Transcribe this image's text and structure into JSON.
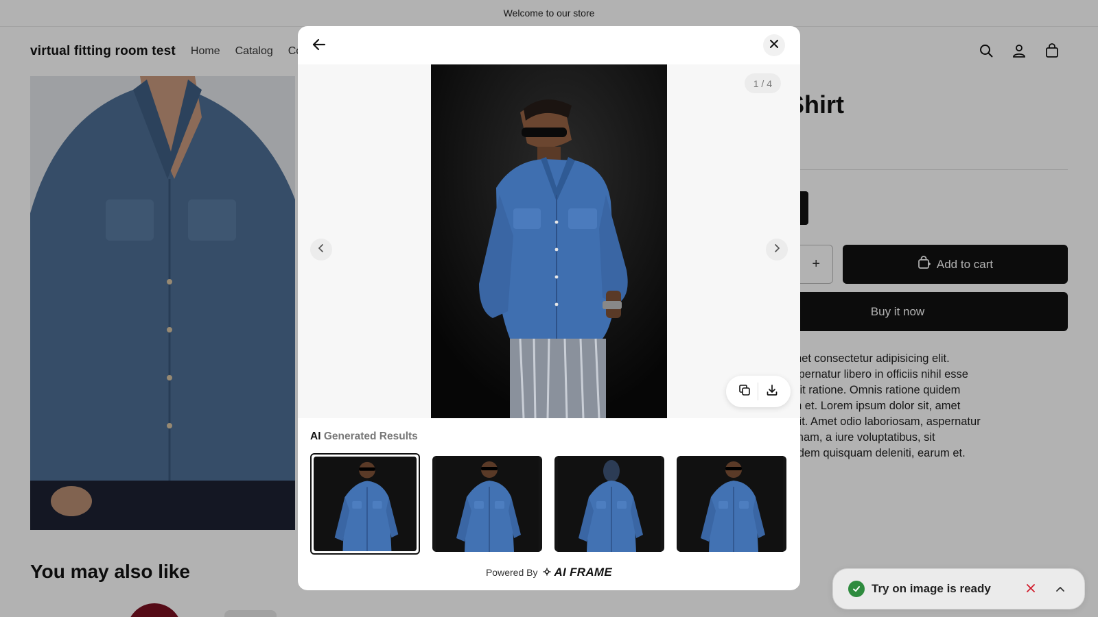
{
  "announcement": {
    "text": "Welcome to our store"
  },
  "header": {
    "store_name": "virtual fitting room test",
    "nav": [
      "Home",
      "Catalog",
      "Co"
    ],
    "icons": [
      "search-icon",
      "account-icon",
      "cart-icon"
    ]
  },
  "product": {
    "title_fragment": "uroy Shirt",
    "qty_plus": "+",
    "add_to_cart": "Add to cart",
    "buy_now": "Buy it now",
    "description_lines": [
      "m dolor sit, amet consectetur adipisicing elit.",
      "aboriosam, aspernatur libero in officiis nihil esse",
      "voluptatibus, sit ratione. Omnis ratione quidem",
      "deleniti, earum et. Lorem ipsum dolor sit, amet",
      "r adipisicing elit. Amet odio laboriosam, aspernatur",
      "ciis nihil esse nam, a iure voluptatibus, sit",
      "nis ratione quidem quisquam deleniti, earum et."
    ]
  },
  "recommendations": {
    "title": "You may also like"
  },
  "modal": {
    "counter": "1 / 4",
    "results_label_strong": "AI",
    "results_label_soft": "Generated Results",
    "thumbnails": 4,
    "selected_index": 0,
    "powered_by": "Powered By",
    "brand": "AI FRAME",
    "icons": [
      "back-arrow-icon",
      "close-icon",
      "chevron-left-icon",
      "chevron-right-icon",
      "copy-icon",
      "download-icon"
    ]
  },
  "toast": {
    "message": "Try on image is ready",
    "colors": {
      "success": "#2e8b3e",
      "dismiss": "#d11a2a"
    }
  }
}
